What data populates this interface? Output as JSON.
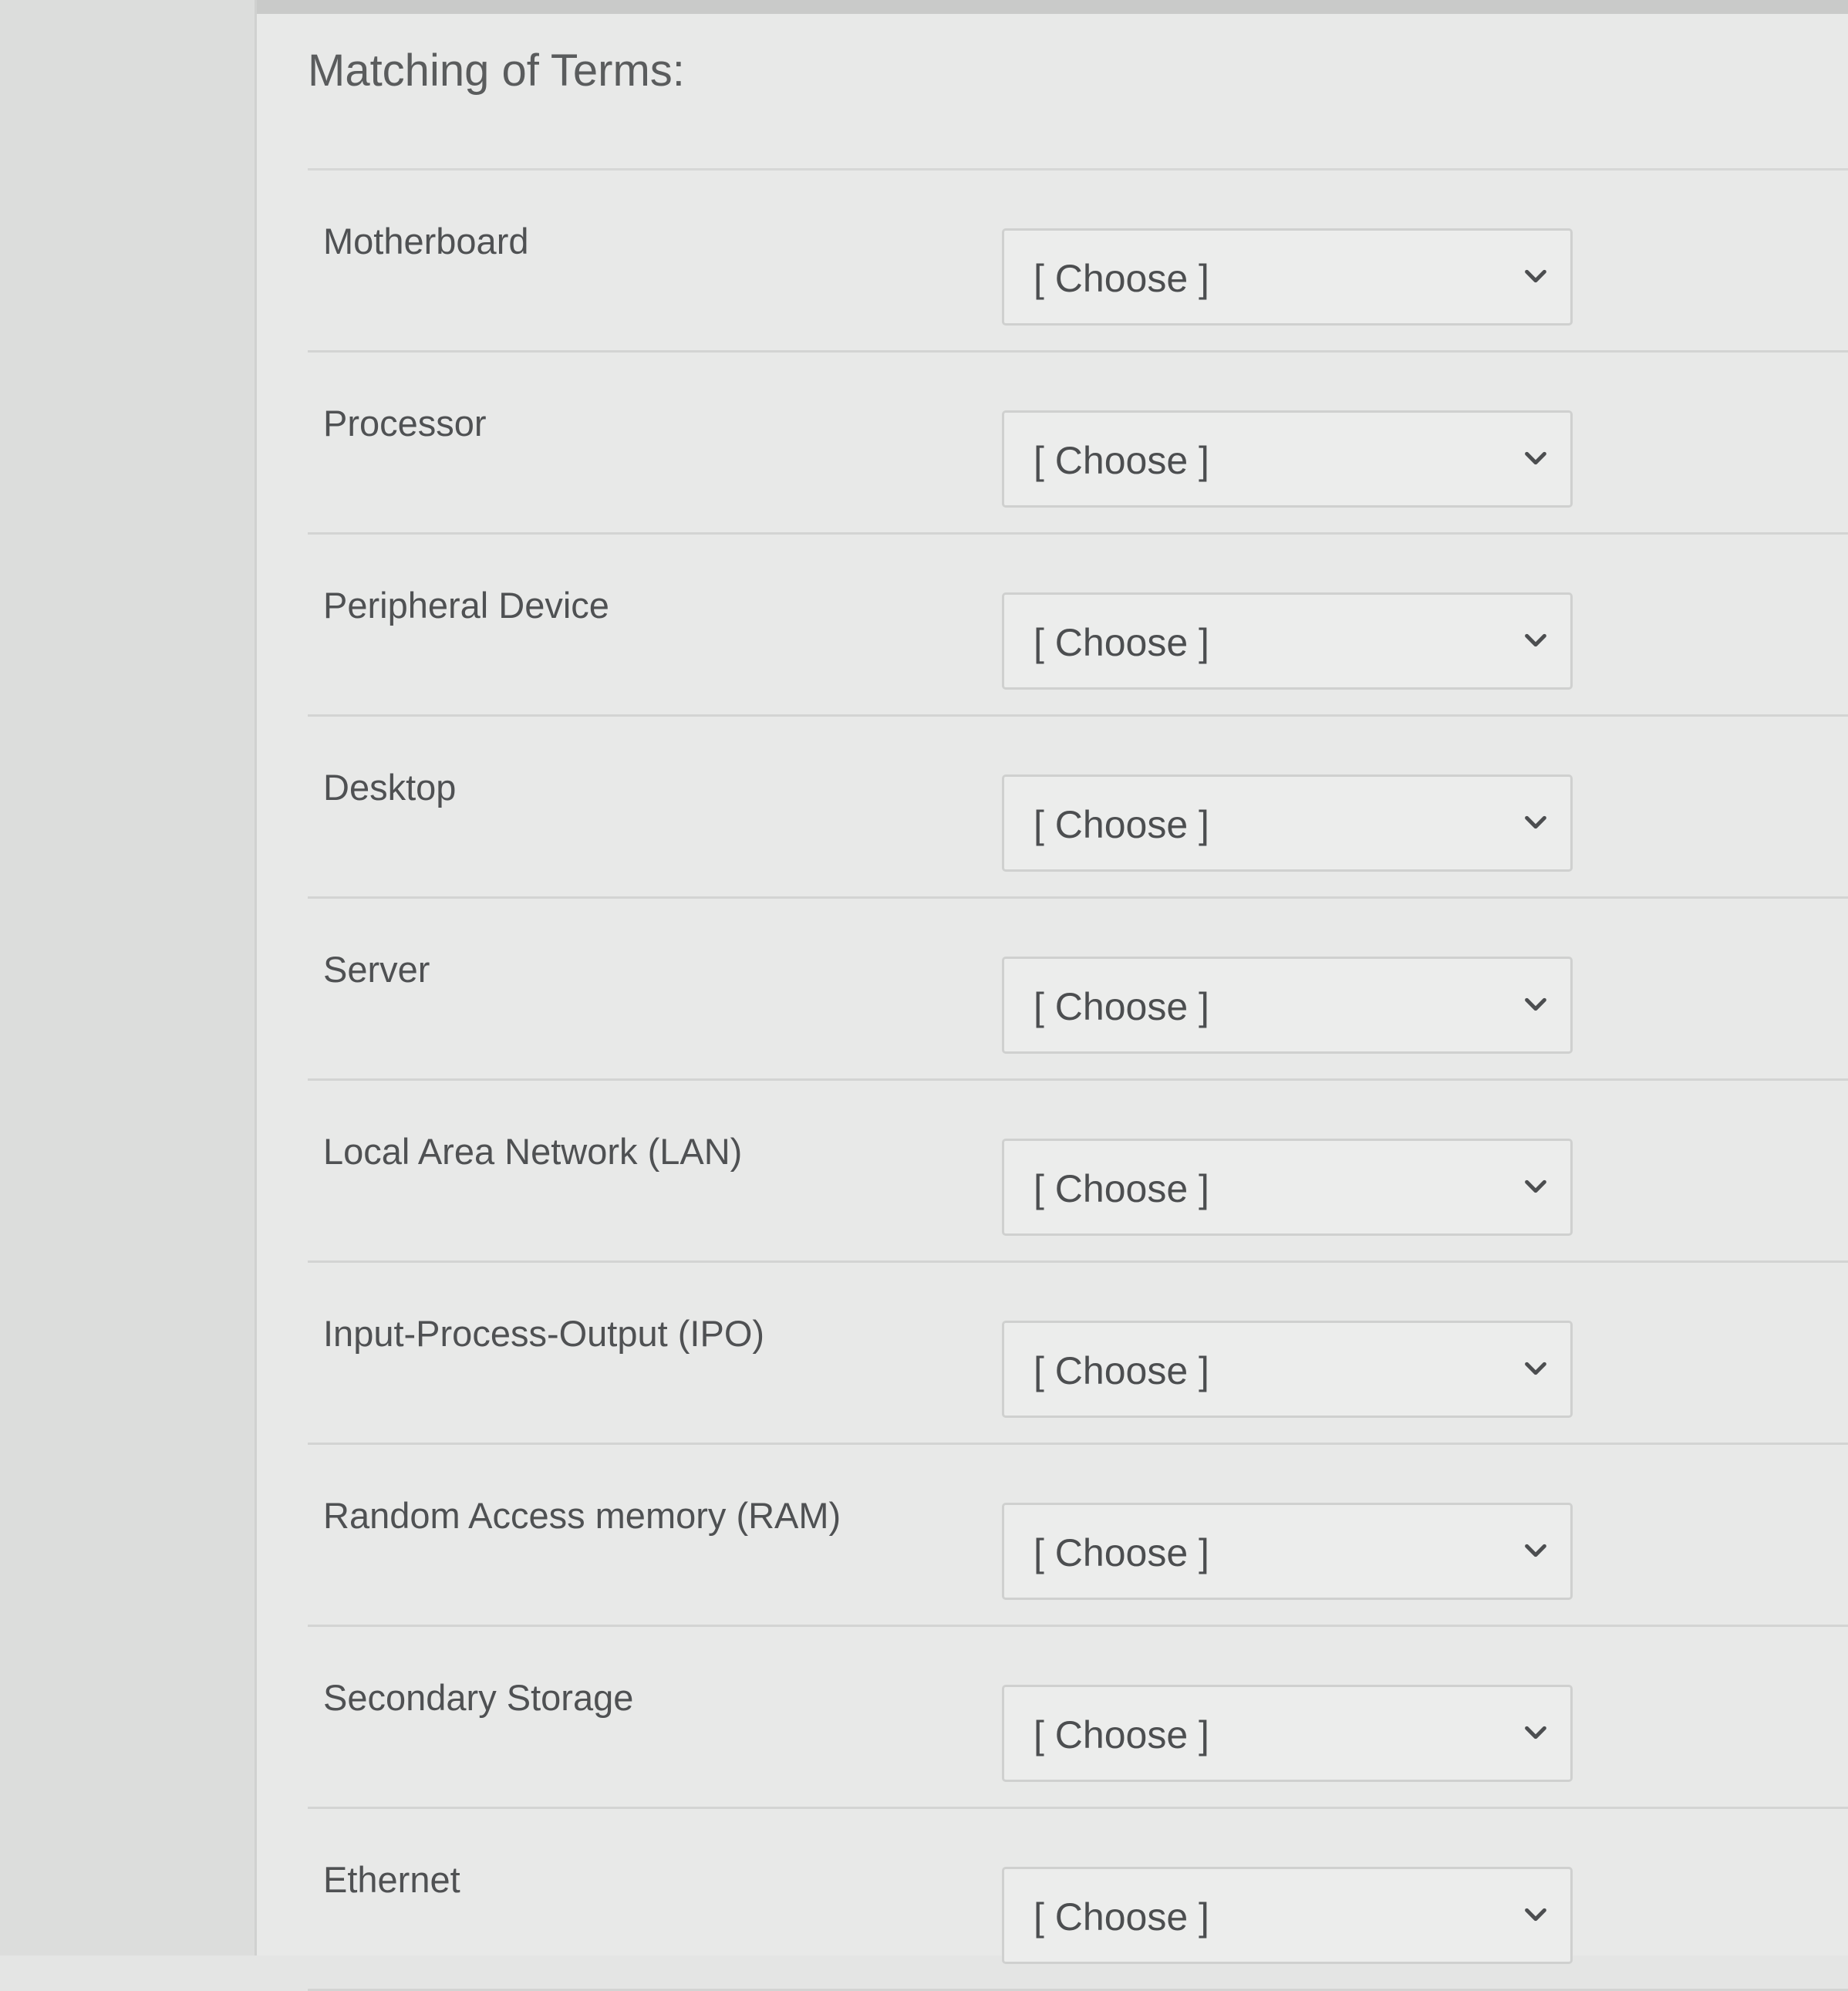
{
  "page": {
    "title": "Matching of Terms:"
  },
  "select_placeholder": "[ Choose ]",
  "icons": {
    "dropdown": "chevron-down-icon"
  },
  "colors": {
    "text": "#4f5153",
    "border": "#cfd0cf",
    "background": "#e8e9e8"
  },
  "terms": [
    {
      "term": "Motherboard",
      "selected": "[ Choose ]"
    },
    {
      "term": "Processor",
      "selected": "[ Choose ]"
    },
    {
      "term": "Peripheral Device",
      "selected": "[ Choose ]"
    },
    {
      "term": "Desktop",
      "selected": "[ Choose ]"
    },
    {
      "term": "Server",
      "selected": "[ Choose ]"
    },
    {
      "term": "Local Area Network (LAN)",
      "selected": "[ Choose ]"
    },
    {
      "term": "Input-Process-Output (IPO)",
      "selected": "[ Choose ]"
    },
    {
      "term": "Random Access memory (RAM)",
      "selected": "[ Choose ]"
    },
    {
      "term": "Secondary Storage",
      "selected": "[ Choose ]"
    },
    {
      "term": "Ethernet",
      "selected": "[ Choose ]"
    }
  ]
}
